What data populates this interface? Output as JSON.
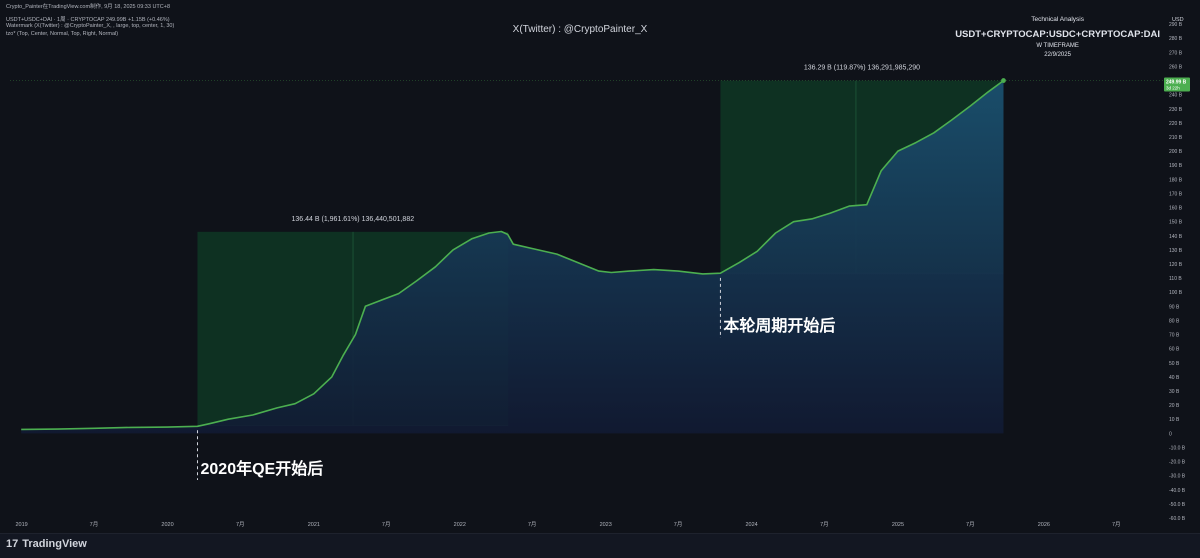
{
  "header": {
    "snapshot_line": "Crypto_Painter在TradingView.com制作, 9月 18, 2025 09:33 UTC+8",
    "symbol_line": "USDT+USDC+DAI · 1周 · CRYPTOCAP  249.99B  +1.15B (+0.46%)",
    "watermark_line": "Watermark (X(Twitter) : @CryptoPainter_X, , large, top, center, 1, 30)",
    "watermark_line2": "tzo* (Top, Center, Normal, Top, Right, Normal)"
  },
  "watermark": "X(Twitter) : @CryptoPainter_X",
  "analysis": {
    "label": "Technical Analysis",
    "symbol": "USDT+CRYPTOCAP:USDC+CRYPTOCAP:DAI",
    "timeframe": "W TIMEFRAME",
    "date": "22/9/2025"
  },
  "footer": {
    "brand": "TradingView",
    "brand_icon": "17"
  },
  "colors": {
    "background": "#0f1219",
    "line": "#4caf50",
    "area_top": "#1a4f6e",
    "area_bottom": "#111a33",
    "box_fill": "#0f4a2a",
    "price_badge": "#4caf50"
  },
  "chart_data": {
    "type": "area",
    "title": "",
    "xlabel": "",
    "ylabel": "",
    "unit": "B",
    "ylim": [
      -60,
      300
    ],
    "xlim": [
      "2018-12-03",
      "2026-10-26"
    ],
    "x_ticks": [
      {
        "date": "2019-01-01",
        "label": "2019"
      },
      {
        "date": "2019-07-01",
        "label": "7月"
      },
      {
        "date": "2020-01-01",
        "label": "2020"
      },
      {
        "date": "2020-07-01",
        "label": "7月"
      },
      {
        "date": "2021-01-01",
        "label": "2021"
      },
      {
        "date": "2021-07-01",
        "label": "7月"
      },
      {
        "date": "2022-01-01",
        "label": "2022"
      },
      {
        "date": "2022-07-01",
        "label": "7月"
      },
      {
        "date": "2023-01-01",
        "label": "2023"
      },
      {
        "date": "2023-07-01",
        "label": "7月"
      },
      {
        "date": "2024-01-01",
        "label": "2024"
      },
      {
        "date": "2024-07-01",
        "label": "7月"
      },
      {
        "date": "2025-01-01",
        "label": "2025"
      },
      {
        "date": "2025-07-01",
        "label": "7月"
      },
      {
        "date": "2026-01-01",
        "label": "2026"
      },
      {
        "date": "2026-07-01",
        "label": "7月"
      }
    ],
    "y_ticks": [
      -60,
      -50,
      -40,
      -30,
      -20,
      -10,
      0,
      10,
      20,
      30,
      40,
      50,
      60,
      70,
      80,
      90,
      100,
      110,
      120,
      130,
      140,
      150,
      160,
      170,
      180,
      190,
      200,
      210,
      220,
      230,
      240,
      250,
      260,
      270,
      280,
      290
    ],
    "y_tick_labels": [
      "-60.0 B",
      "-50.0 B",
      "-40.0 B",
      "-30.0 B",
      "-20.0 B",
      "-10.0 B",
      "0",
      "10 B",
      "20 B",
      "30 B",
      "40 B",
      "50 B",
      "60 B",
      "70 B",
      "80 B",
      "90 B",
      "100 B",
      "110 B",
      "120 B",
      "130 B",
      "140 B",
      "150 B",
      "160 B",
      "170 B",
      "180 B",
      "190 B",
      "200 B",
      "210 B",
      "220 B",
      "230 B",
      "240 B",
      "250 B",
      "260 B",
      "270 B",
      "280 B",
      "290 B"
    ],
    "axis_unit_label": "USD",
    "series": [
      {
        "x": [
          "2018-12-31",
          "2019-04-01",
          "2019-07-01",
          "2019-10-01",
          "2020-01-01",
          "2020-03-16",
          "2020-04-15",
          "2020-06-01",
          "2020-08-01",
          "2020-10-01",
          "2020-11-15",
          "2021-01-01",
          "2021-02-15",
          "2021-03-15",
          "2021-04-15",
          "2021-05-10",
          "2021-06-15",
          "2021-08-01",
          "2021-09-15",
          "2021-11-01",
          "2021-12-15",
          "2022-02-01",
          "2022-03-15",
          "2022-04-15",
          "2022-05-01",
          "2022-05-15",
          "2022-07-01",
          "2022-09-01",
          "2022-11-01",
          "2022-12-15",
          "2023-01-15",
          "2023-03-01",
          "2023-05-01",
          "2023-07-01",
          "2023-09-01",
          "2023-10-15",
          "2023-12-01",
          "2024-01-15",
          "2024-03-01",
          "2024-04-15",
          "2024-06-01",
          "2024-07-15",
          "2024-09-01",
          "2024-10-15",
          "2024-11-20",
          "2025-01-01",
          "2025-02-15",
          "2025-04-01",
          "2025-05-15",
          "2025-07-01",
          "2025-08-15",
          "2025-09-22"
        ],
        "values": [
          2.8,
          3.0,
          3.6,
          4.2,
          4.4,
          5.0,
          6.8,
          10,
          13,
          18,
          21,
          28,
          40,
          55,
          70,
          90,
          94,
          99,
          108,
          118,
          130,
          138,
          142,
          143,
          141,
          134,
          131,
          127,
          120,
          115,
          114,
          115,
          116,
          115,
          113,
          113.5,
          121,
          129,
          142,
          150,
          152,
          156,
          161,
          162,
          186,
          200,
          206,
          213,
          222,
          232,
          242,
          250
        ]
      }
    ],
    "price_label": "249.99 B",
    "price_sublabel": "3d 22h",
    "markers": [
      {
        "date": "2020-03-16",
        "label": "2020年QE开始后"
      },
      {
        "date": "2023-10-15",
        "label": "本轮周期开始后"
      }
    ],
    "ranges": [
      {
        "x_start": "2020-03-16",
        "x_end": "2022-05-02",
        "y_low": 5.5,
        "y_high": 142.8,
        "mid_date": "2021-04-09",
        "label": "136.44 B (1,961.61%) 136,440,501,882"
      },
      {
        "x_start": "2023-10-15",
        "x_end": "2025-09-22",
        "y_low": 113.5,
        "y_high": 249.9,
        "mid_date": "2024-09-18",
        "label": "136.29 B (119.87%) 136,291,985,290"
      }
    ]
  }
}
